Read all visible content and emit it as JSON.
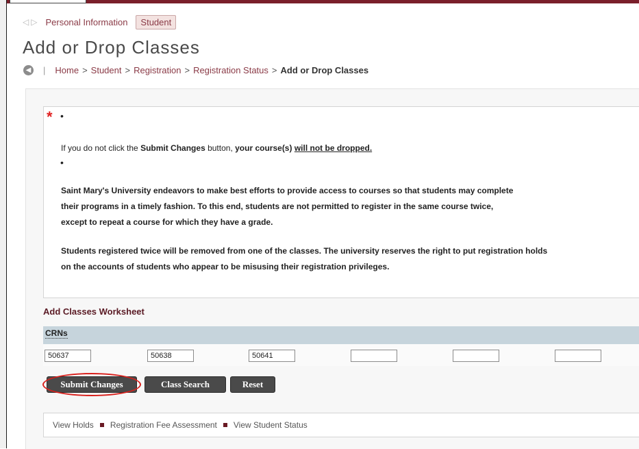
{
  "header": {
    "tabs": [
      {
        "label": "Personal Information"
      },
      {
        "label": "Student"
      }
    ],
    "page_title": "Add or Drop Classes"
  },
  "breadcrumb": {
    "items": [
      "Home",
      "Student",
      "Registration",
      "Registration Status"
    ],
    "current": "Add or Drop Classes",
    "separator": ">"
  },
  "notice": {
    "line1_prefix": "If you do not click the ",
    "line1_button": "Submit Changes",
    "line1_mid": " button, ",
    "line1_bold": "your course(s) ",
    "line1_underline": "will not be dropped.",
    "para1_line1": "Saint Mary's University endeavors to make best efforts to provide access to courses so that students may complete",
    "para1_line2": "their programs in a timely fashion. To this end, students are not permitted to register in the same course twice,",
    "para1_line3": "except to repeat a course for which they have a grade.",
    "para2_line1": "Students registered twice will be removed from one of the classes. The university reserves the right to put registration holds",
    "para2_line2": "on the accounts of students who appear to be misusing their registration privileges."
  },
  "worksheet": {
    "heading": "Add Classes Worksheet",
    "crn_label": "CRNs",
    "crns": [
      "50637",
      "50638",
      "50641",
      "",
      "",
      ""
    ]
  },
  "buttons": {
    "submit": "Submit Changes",
    "class_search": "Class Search",
    "reset": "Reset"
  },
  "footer_links": [
    "View Holds",
    "Registration Fee Assessment",
    "View Student Status"
  ],
  "colors": {
    "accent": "#7a1f2b",
    "link": "#8a3a46",
    "highlight_circle": "#d9201c",
    "crn_bar": "#c6d4dc"
  }
}
